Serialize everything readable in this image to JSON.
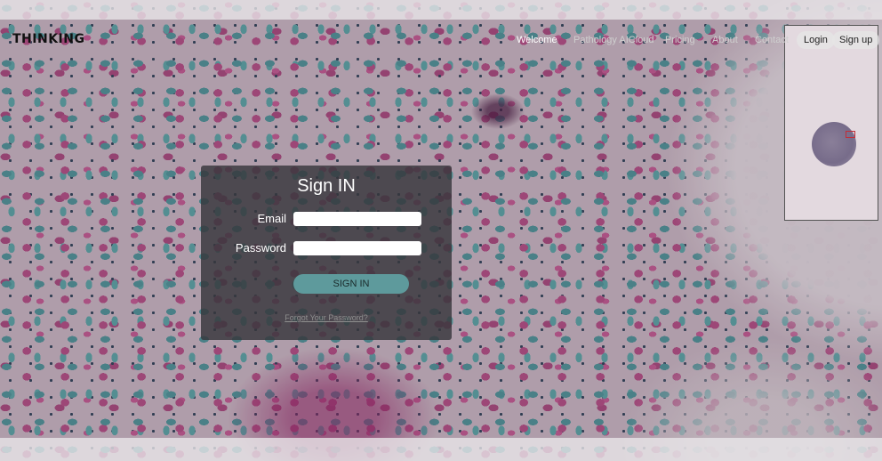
{
  "brand": "THINKING",
  "nav": {
    "links": [
      "Welcome",
      "Pathology AICloud",
      "Pricing",
      "About",
      "Contact"
    ],
    "login_label": "Login",
    "signup_label": "Sign up"
  },
  "signin": {
    "title": "Sign IN",
    "email_label": "Email",
    "email_value": "",
    "password_label": "Password",
    "password_value": "",
    "button_label": "SIGN IN",
    "forgot_label": "Forgot Your Password?"
  },
  "colors": {
    "accent": "#5e9a9c",
    "minimap_viewport": "#c0303a"
  }
}
